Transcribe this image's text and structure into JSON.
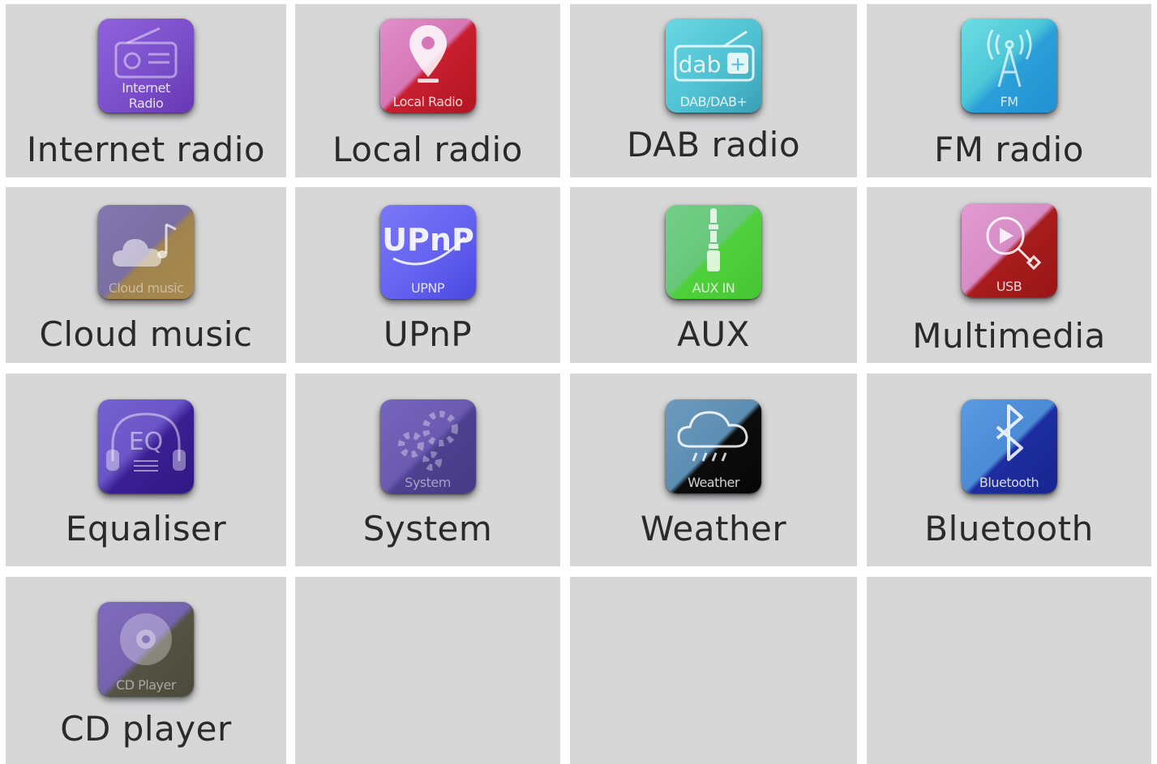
{
  "tiles": [
    {
      "label": "Internet radio",
      "icon": "internet-radio-icon",
      "icon_caption": "Internet\nRadio",
      "colors": [
        "#8c5bd6",
        "#6a3db8"
      ]
    },
    {
      "label": "Local radio",
      "icon": "local-radio-icon",
      "icon_caption": "Local Radio",
      "colors": [
        "#d97cc0",
        "#c81f2f"
      ]
    },
    {
      "label": "DAB radio",
      "icon": "dab-radio-icon",
      "icon_caption": "DAB/DAB+",
      "colors": [
        "#5fd1de",
        "#3fa8bd"
      ]
    },
    {
      "label": "FM radio",
      "icon": "fm-radio-icon",
      "icon_caption": "FM",
      "colors": [
        "#58d4de",
        "#2aa2d9"
      ]
    },
    {
      "label": "Cloud music",
      "icon": "cloud-music-icon",
      "icon_caption": "Cloud music",
      "colors": [
        "#7d6fa7",
        "#a8834b"
      ]
    },
    {
      "label": "UPnP",
      "icon": "upnp-icon",
      "icon_caption": "UPNP",
      "colors": [
        "#6d6cf5",
        "#4a47e2"
      ]
    },
    {
      "label": "AUX",
      "icon": "aux-icon",
      "icon_caption": "AUX IN",
      "colors": [
        "#67c97c",
        "#4ed03a"
      ]
    },
    {
      "label": "Multimedia",
      "icon": "multimedia-icon",
      "icon_caption": "USB",
      "colors": [
        "#d98cc8",
        "#a21818"
      ]
    },
    {
      "label": "Equaliser",
      "icon": "equaliser-icon",
      "icon_caption": "",
      "colors": [
        "#6e59c9",
        "#3b1f94"
      ]
    },
    {
      "label": "System",
      "icon": "system-icon",
      "icon_caption": "System",
      "colors": [
        "#6b5cb4",
        "#4a3d8c"
      ]
    },
    {
      "label": "Weather",
      "icon": "weather-icon",
      "icon_caption": "Weather",
      "colors": [
        "#5f8fb6",
        "#0b0b0b"
      ]
    },
    {
      "label": "Bluetooth",
      "icon": "bluetooth-icon",
      "icon_caption": "Bluetooth",
      "colors": [
        "#4f8fd8",
        "#1b2a9a"
      ]
    },
    {
      "label": "CD player",
      "icon": "cd-player-icon",
      "icon_caption": "CD Player",
      "colors": [
        "#7c67b8",
        "#4c4a3a"
      ]
    }
  ]
}
